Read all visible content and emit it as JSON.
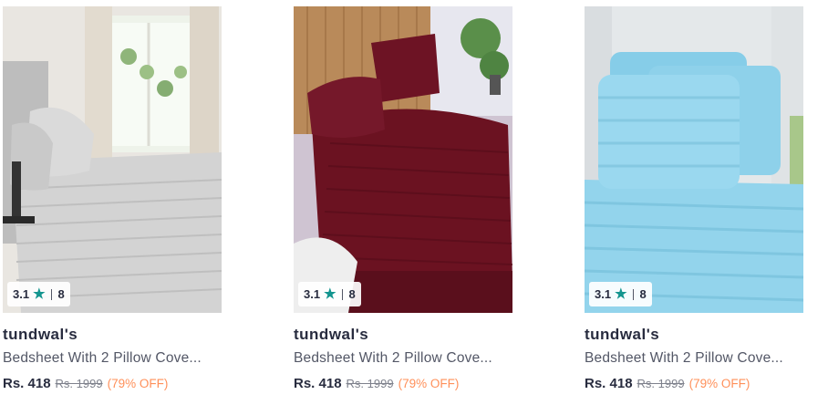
{
  "products": [
    {
      "brand": "tundwal's",
      "title": "Bedsheet With 2 Pillow Cove...",
      "price": "Rs. 418",
      "mrp": "Rs. 1999",
      "discount": "(79% OFF)",
      "rating": "3.1",
      "rating_count": "8",
      "image_color": "#d6d6d6"
    },
    {
      "brand": "tundwal's",
      "title": "Bedsheet With 2 Pillow Cove...",
      "price": "Rs. 418",
      "mrp": "Rs. 1999",
      "discount": "(79% OFF)",
      "rating": "3.1",
      "rating_count": "8",
      "image_color": "#6a1020"
    },
    {
      "brand": "tundwal's",
      "title": "Bedsheet With 2 Pillow Cove...",
      "price": "Rs. 418",
      "mrp": "Rs. 1999",
      "discount": "(79% OFF)",
      "rating": "3.1",
      "rating_count": "8",
      "image_color": "#8fd3ea"
    }
  ],
  "colors": {
    "star": "#14958f",
    "discount": "#ff905a",
    "text": "#282c3f"
  }
}
